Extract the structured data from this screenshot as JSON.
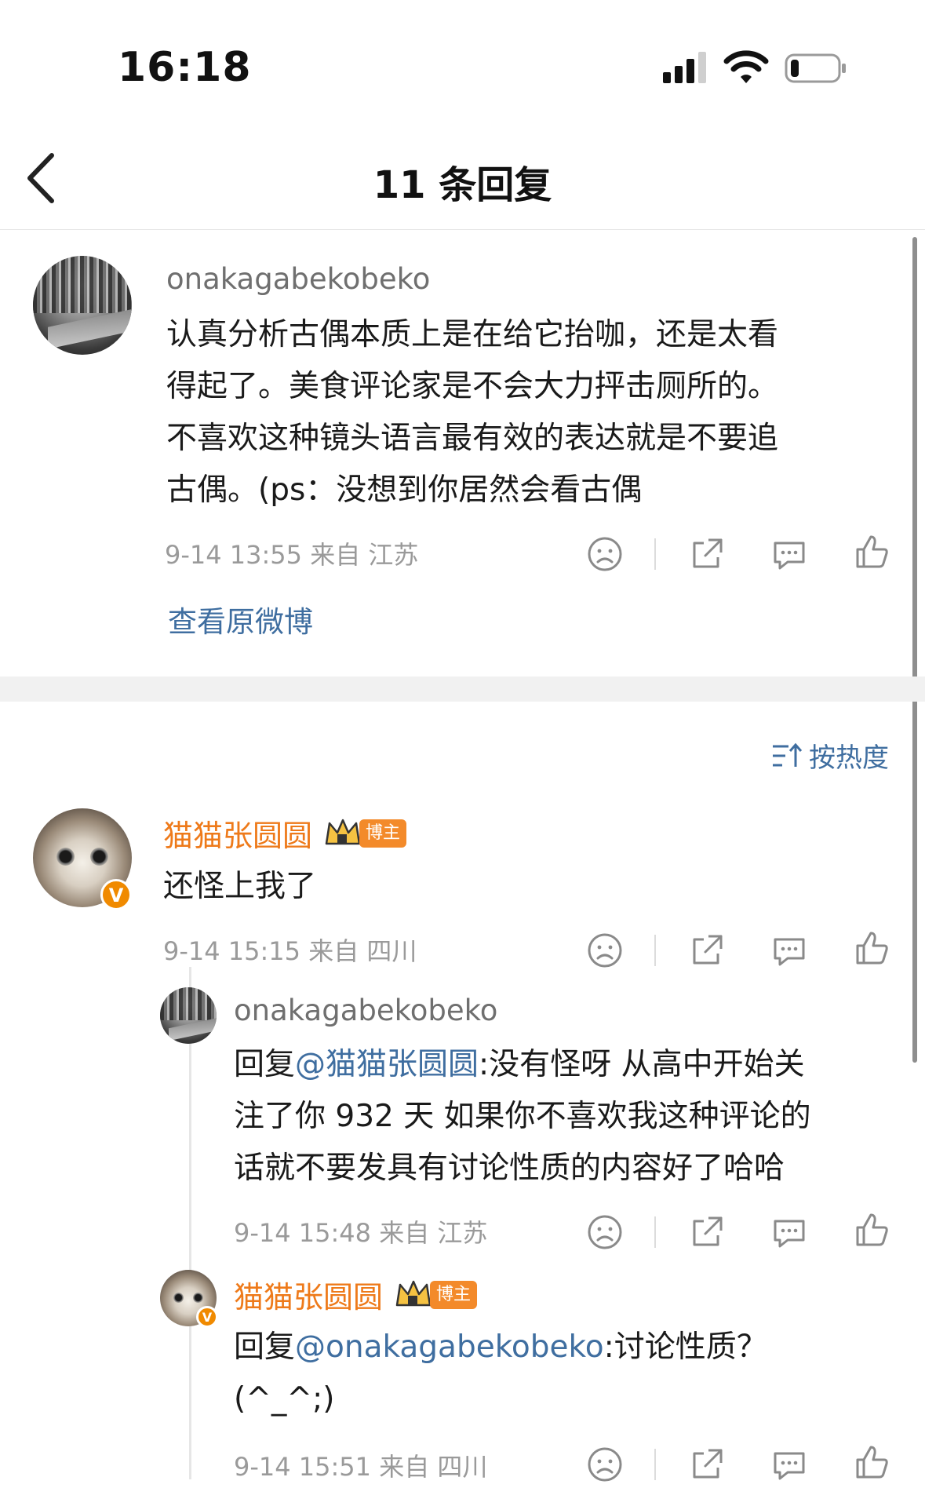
{
  "status_bar": {
    "time": "16:18"
  },
  "header": {
    "title": "11 条回复"
  },
  "original": {
    "username": "onakagabekobeko",
    "lines": [
      "认真分析古偶本质上是在给它抬咖，还是太看",
      "得起了。美食评论家是不会大力抨击厕所的。",
      "不喜欢这种镜头语言最有效的表达就是不要追",
      "古偶。(ps：没想到你居然会看古偶"
    ],
    "meta": "9-14 13:55  来自 江苏",
    "view_original": "查看原微博"
  },
  "sort_label": "按热度",
  "replies": [
    {
      "username": "猫猫张圆圆",
      "badge": "博主",
      "verified": "V",
      "text": "还怪上我了",
      "meta": "9-14 15:15  来自 四川"
    },
    {
      "username": "onakagabekobeko",
      "reply_prefix": "回复",
      "mention": "@猫猫张圆圆",
      "lines": [
        ":没有怪呀 从高中开始关",
        "注了你 932 天 如果你不喜欢我这种评论的",
        "话就不要发具有讨论性质的内容好了哈哈"
      ],
      "meta": "9-14 15:48  来自 江苏"
    },
    {
      "username": "猫猫张圆圆",
      "badge": "博主",
      "verified": "V",
      "reply_prefix": "回复",
      "mention": "@onakagabekobeko",
      "lines": [
        ":讨论性质？",
        "(^_^;)"
      ],
      "meta": "9-14 15:51  来自 四川"
    }
  ],
  "icons": {
    "dislike": "sad-face-icon",
    "share": "share-icon",
    "comment": "comment-icon",
    "like": "thumbs-up-icon"
  },
  "colors": {
    "link": "#3f6ea0",
    "vip_name": "#ee7a1a",
    "badge": "#f38a2a",
    "meta": "#9a9a9a"
  }
}
